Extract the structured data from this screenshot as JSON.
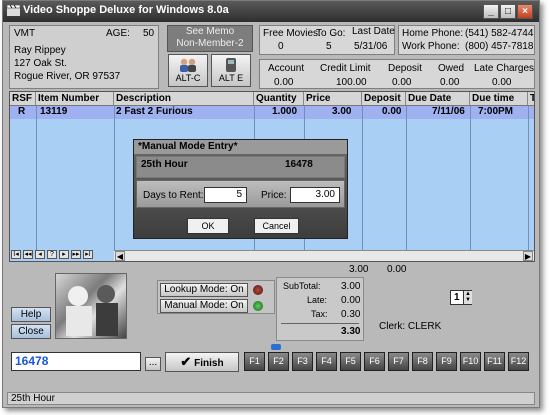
{
  "window": {
    "title": "Video Shoppe Deluxe for Windows 8.0a",
    "buttons": [
      "_",
      "□",
      "×"
    ]
  },
  "customer": {
    "code": "VMT",
    "age_label": "AGE:",
    "age_value": "50",
    "name": "Ray Rippey",
    "address1": "127 Oak St.",
    "address2": "Rogue River, OR 97537"
  },
  "memo": {
    "line1": "See Memo",
    "line2": "Non-Member-2",
    "alt_c": "ALT-C",
    "alt_e": "ALT E"
  },
  "movies": {
    "free_label": "Free Movies:",
    "free_value": "0",
    "togo_label": "To Go:",
    "togo_value": "5",
    "last_date_label": "Last Date",
    "last_date_value": "5/31/06"
  },
  "phones": {
    "home_label": "Home Phone:",
    "home_value": "(541)  582-4744",
    "work_label": "Work Phone:",
    "work_value": "(800)  457-7818"
  },
  "account": {
    "headers": [
      "Account",
      "Credit Limit",
      "Deposit",
      "Owed",
      "Late Charges"
    ],
    "values": [
      "0.00",
      "100.00",
      "0.00",
      "0.00",
      "0.00"
    ]
  },
  "grid": {
    "columns": [
      "RSF",
      "Item Number",
      "Description",
      "Quantity",
      "Price",
      "Deposit",
      "Due Date",
      "Due time",
      "T"
    ],
    "rows": [
      {
        "rsf": "R",
        "item": "13119",
        "description": "2 Fast 2 Furious",
        "quantity": "1.000",
        "price": "3.00",
        "deposit": "0.00",
        "due_date": "7/11/06",
        "due_time": "7:00PM"
      }
    ],
    "nav": [
      "I◂",
      "◂◂",
      "◂",
      "?",
      "▸",
      "▸▸",
      "▸I"
    ],
    "total_price": "3.00",
    "total_deposit": "0.00"
  },
  "dialog": {
    "title": "*Manual Mode Entry*",
    "item_title": "25th Hour",
    "item_number": "16478",
    "days_label": "Days to Rent:",
    "days_value": "5",
    "price_label": "Price:",
    "price_value": "3.00",
    "ok": "OK",
    "cancel": "Cancel"
  },
  "controls": {
    "help": "Help",
    "close": "Close",
    "lookup_mode": "Lookup Mode: On",
    "manual_mode": "Manual Mode: On"
  },
  "totals": {
    "subtotal_label": "SubTotal:",
    "subtotal_value": "3.00",
    "late_label": "Late:",
    "late_value": "0.00",
    "tax_label": "Tax:",
    "tax_value": "0.30",
    "total_value": "3.30"
  },
  "spinner_value": "1",
  "clerk": "Clerk: CLERK",
  "entry": {
    "value": "16478",
    "browse": "...",
    "finish": "Finish"
  },
  "fkeys": [
    "F1",
    "F2",
    "F3",
    "F4",
    "F5",
    "F6",
    "F7",
    "F8",
    "F9",
    "F10",
    "F11",
    "F12"
  ],
  "status": "25th Hour",
  "colors": {
    "grid_bg": "#a9cff5",
    "highlight_row": "#9fb1f0",
    "titlebar": "#3c3c3c",
    "entry_text": "#1a57d6"
  }
}
